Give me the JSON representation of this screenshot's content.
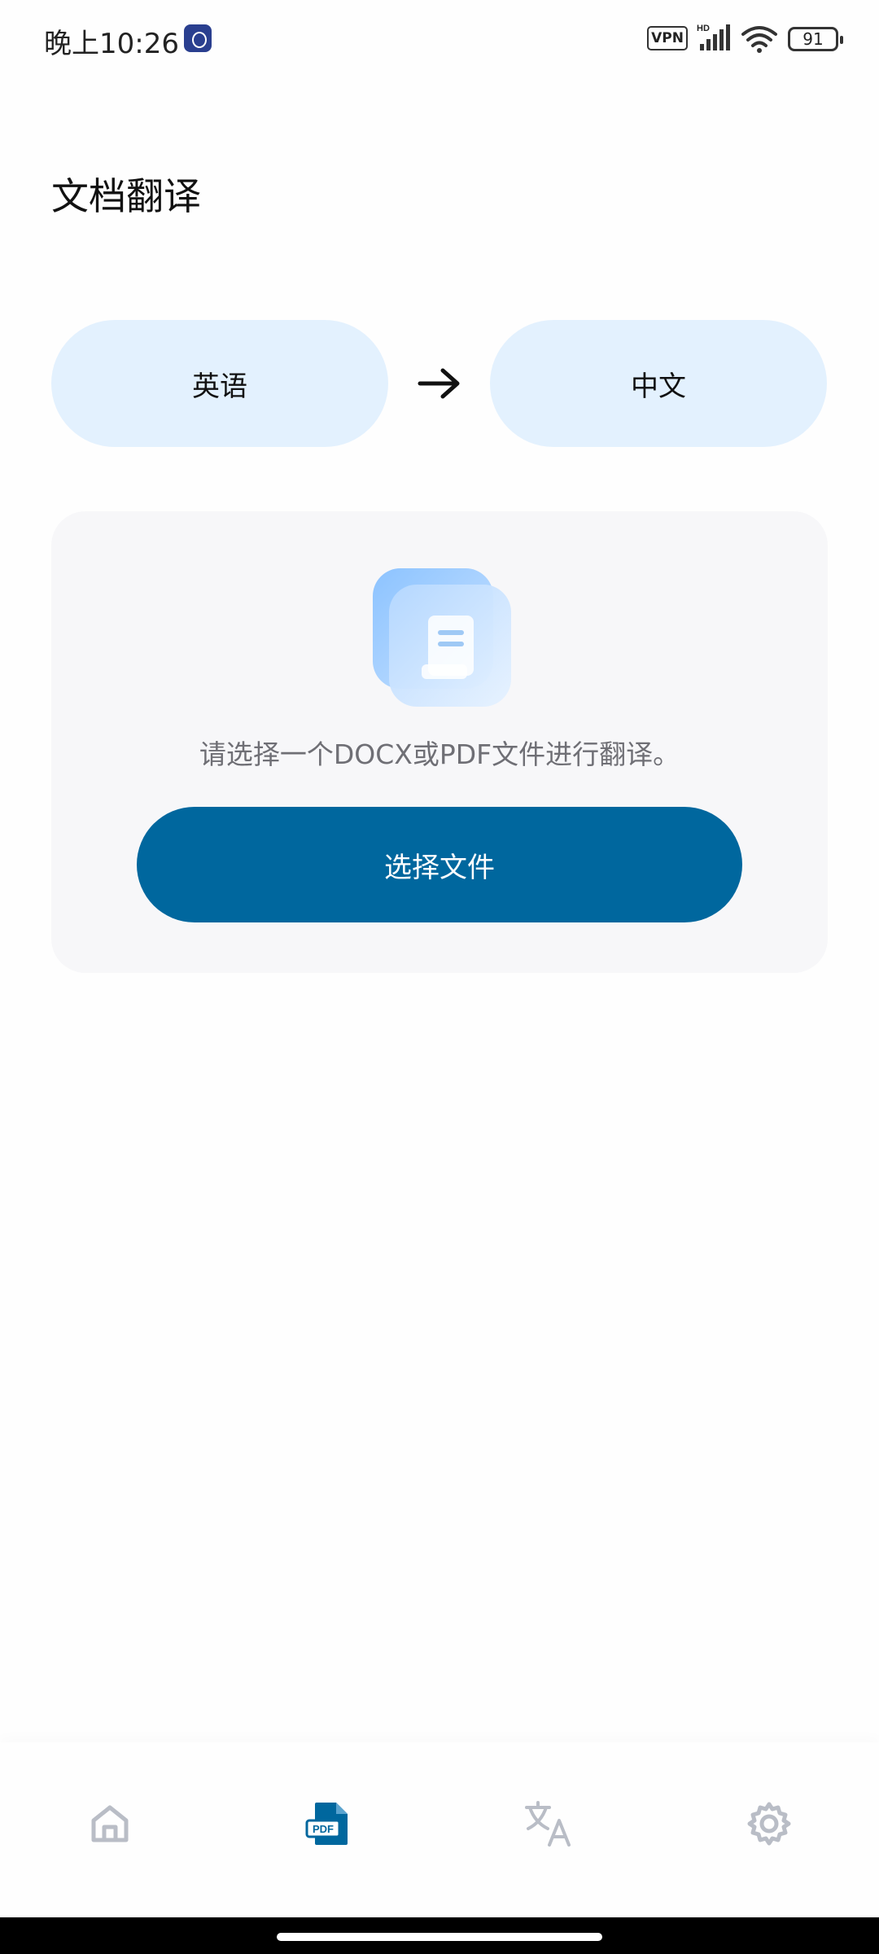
{
  "status_bar": {
    "time": "晚上10:26",
    "vpn": "VPN",
    "network": "HD",
    "battery": "91"
  },
  "header": {
    "title": "文档翻译"
  },
  "languages": {
    "source": "英语",
    "target": "中文"
  },
  "upload": {
    "hint": "请选择一个DOCX或PDF文件进行翻译。",
    "button_label": "选择文件"
  },
  "nav": {
    "items": [
      {
        "icon": "home-icon",
        "active": false
      },
      {
        "icon": "pdf-document-icon",
        "active": true
      },
      {
        "icon": "translate-icon",
        "active": false
      },
      {
        "icon": "gear-icon",
        "active": false
      }
    ],
    "active_color": "#00679E",
    "inactive_color": "#B9BDC6"
  },
  "colors": {
    "accent": "#00679E",
    "pill_background": "#E3F1FE",
    "card_background": "#F7F7F9"
  }
}
